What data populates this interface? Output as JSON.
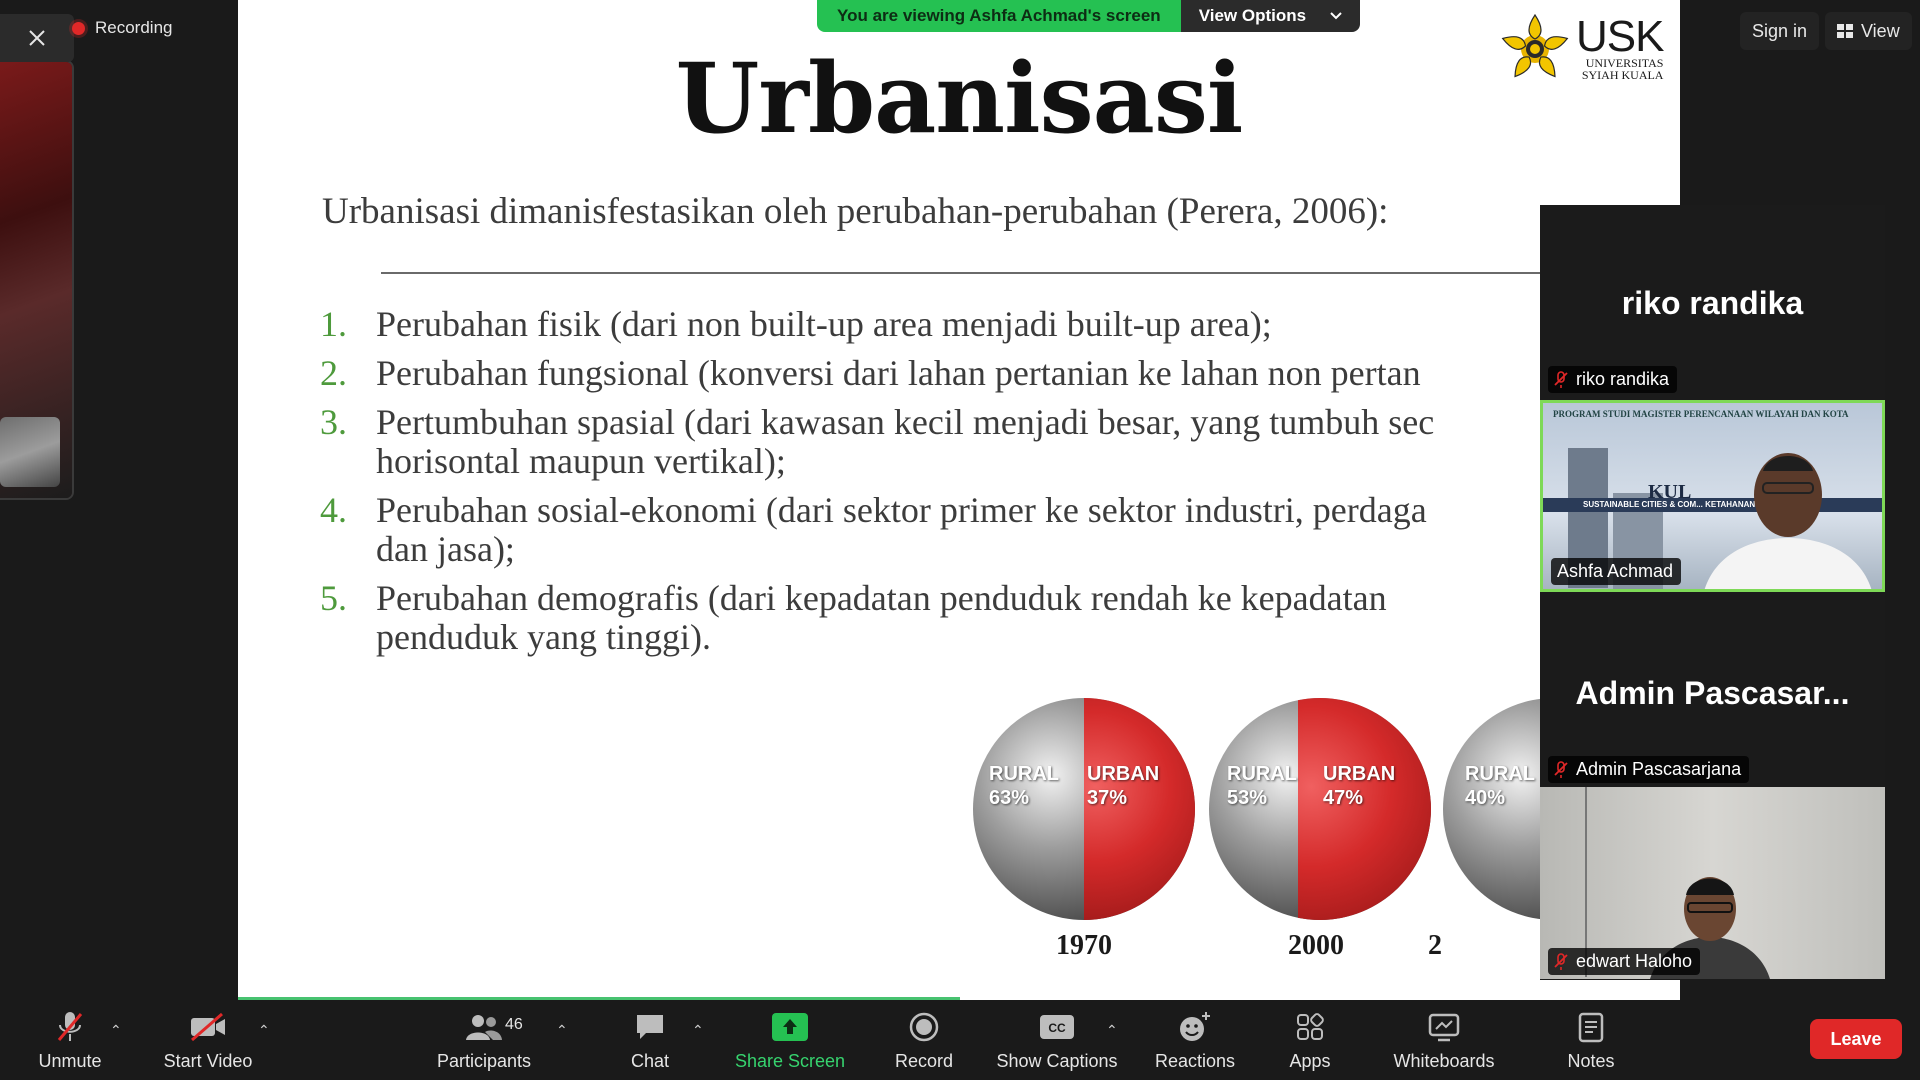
{
  "recording": {
    "label": "Recording"
  },
  "banner": {
    "viewing": "You are viewing Ashfa Achmad's screen",
    "options": "View Options"
  },
  "topbar": {
    "sign_in": "Sign in",
    "view": "View"
  },
  "slide": {
    "title": "Urbanisasi",
    "subtitle": "Urbanisasi  dimanisfestasikan oleh perubahan-perubahan (Perera, 2006):",
    "logo": {
      "name": "USK",
      "line1": "UNIVERSITAS",
      "line2": "SYIAH KUALA"
    },
    "points": [
      {
        "num": "1.",
        "lines": [
          "Perubahan fisik (dari non built-up area menjadi built-up area);"
        ]
      },
      {
        "num": "2.",
        "lines": [
          "Perubahan fungsional (konversi dari lahan pertanian ke lahan non pertan"
        ]
      },
      {
        "num": "3.",
        "lines": [
          "Pertumbuhan spasial (dari kawasan kecil menjadi besar, yang tumbuh sec",
          "horisontal maupun vertikal);"
        ]
      },
      {
        "num": "4.",
        "lines": [
          "Perubahan sosial-ekonomi (dari sektor primer ke sektor industri, perdaga",
          "dan jasa);"
        ]
      },
      {
        "num": "5.",
        "lines": [
          "Perubahan demografis (dari kepadatan penduduk rendah ke kepadatan",
          "penduduk yang tinggi)."
        ]
      }
    ],
    "globes": [
      {
        "year": "1970",
        "rural_label": "RURAL",
        "rural": "63%",
        "urban_label": "URBAN",
        "urban": "37%",
        "urban_share": 0.37
      },
      {
        "year": "2000",
        "rural_label": "RURAL",
        "rural": "53%",
        "urban_label": "URBAN",
        "urban": "47%",
        "urban_share": 0.47
      },
      {
        "year": "2",
        "rural_label": "RURAL",
        "rural": "40%",
        "urban_label": "",
        "urban": "",
        "urban_share": 0.6
      }
    ]
  },
  "gallery": {
    "tiles": [
      {
        "big_name": "riko randika",
        "name": "riko randika",
        "muted": true,
        "video": false
      },
      {
        "big_name": "",
        "name": "Ashfa Achmad",
        "muted": false,
        "video": true,
        "backdrop_heading": "PROGRAM STUDI MAGISTER PERENCANAAN WILAYAH DAN KOTA",
        "backdrop_kul": "KUL",
        "backdrop_stripe": "SUSTAINABLE CITIES & COM...   KETAHANAN IKLIM"
      },
      {
        "big_name": "Admin  Pascasar...",
        "name": "Admin Pascasarjana",
        "muted": true,
        "video": false
      },
      {
        "big_name": "",
        "name": "edwart Haloho",
        "muted": true,
        "video": true
      }
    ]
  },
  "toolbar": {
    "unmute": "Unmute",
    "start_video": "Start Video",
    "participants": "Participants",
    "participants_count": "46",
    "chat": "Chat",
    "share_screen": "Share Screen",
    "record": "Record",
    "show_captions": "Show Captions",
    "captions_badge": "CC",
    "reactions": "Reactions",
    "apps": "Apps",
    "whiteboards": "Whiteboards",
    "notes": "Notes",
    "leave": "Leave"
  },
  "colors": {
    "accent_green": "#25c152",
    "leave_red": "#e02828",
    "share_green": "#36d36e",
    "active_border": "#7ed957"
  }
}
